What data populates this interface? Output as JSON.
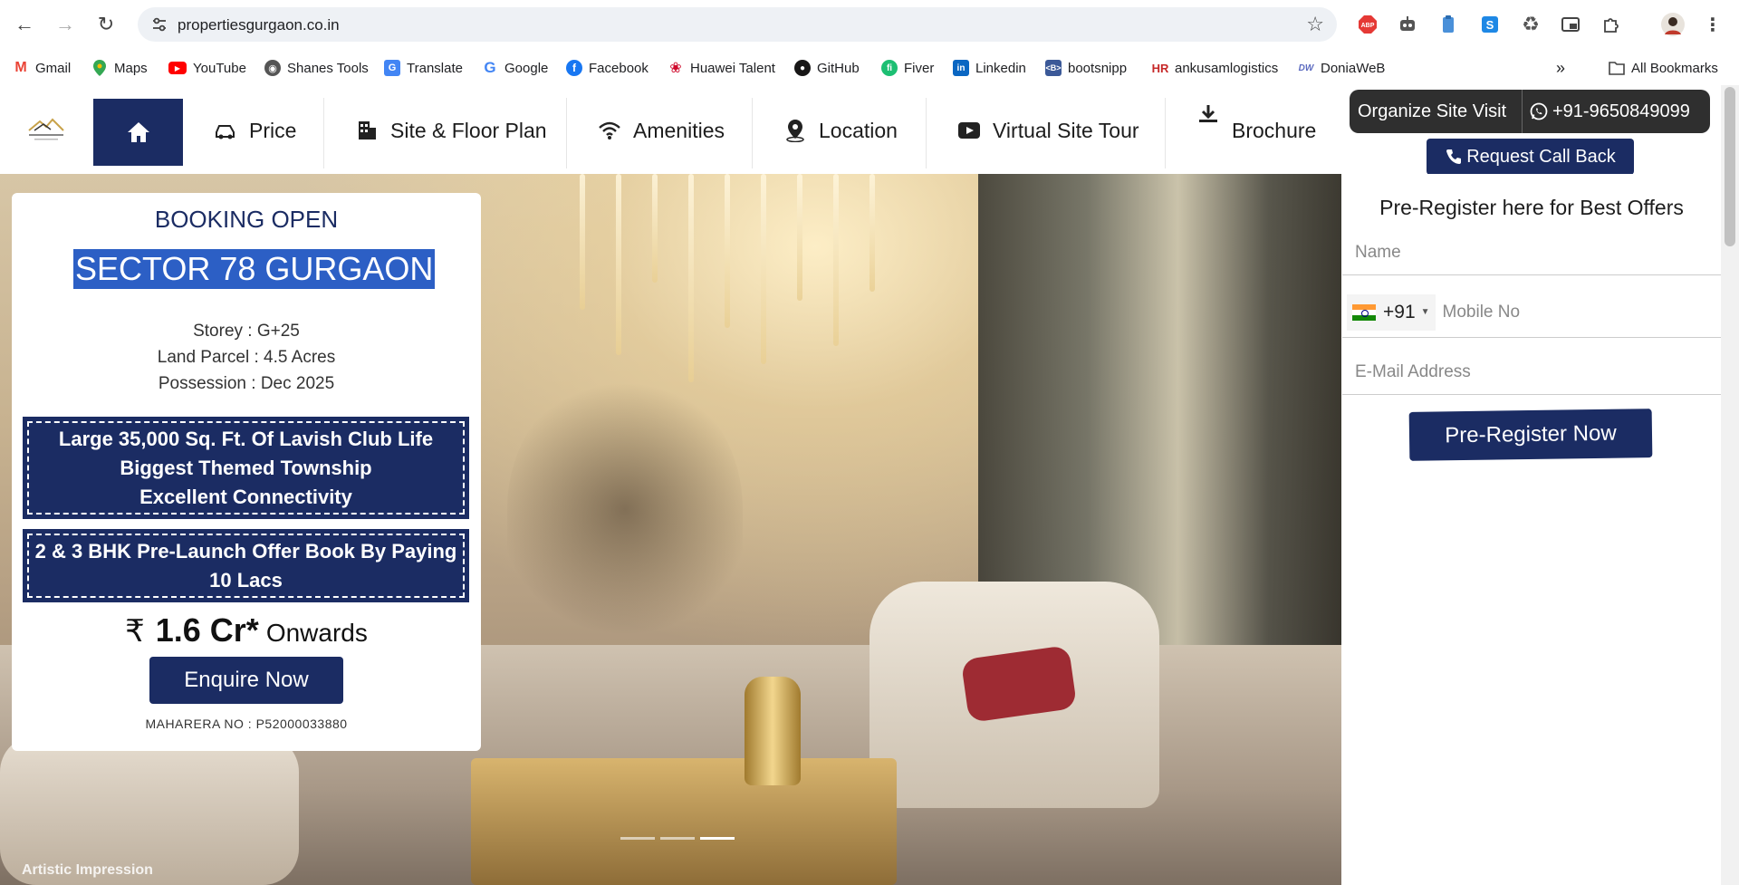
{
  "browser": {
    "url": "propertiesgurgaon.co.in",
    "bookmarks": [
      {
        "label": "Gmail",
        "icon": "gmail-icon",
        "color": "#EA4335"
      },
      {
        "label": "Maps",
        "icon": "maps-icon",
        "color": "#34A853"
      },
      {
        "label": "YouTube",
        "icon": "youtube-icon",
        "color": "#FF0000"
      },
      {
        "label": "Shanes Tools",
        "icon": "globe-icon",
        "color": "#555555"
      },
      {
        "label": "Translate",
        "icon": "translate-icon",
        "color": "#4285F4"
      },
      {
        "label": "Google",
        "icon": "google-icon",
        "color": "#4285F4"
      },
      {
        "label": "Facebook",
        "icon": "facebook-icon",
        "color": "#1877F2"
      },
      {
        "label": "Huawei Talent",
        "icon": "huawei-icon",
        "color": "#CF0A2C"
      },
      {
        "label": "GitHub",
        "icon": "github-icon",
        "color": "#181717"
      },
      {
        "label": "Fiver",
        "icon": "fiverr-icon",
        "color": "#1DBF73"
      },
      {
        "label": "Linkedin",
        "icon": "linkedin-icon",
        "color": "#0A66C2"
      },
      {
        "label": "bootsnipp",
        "icon": "bootsnipp-icon",
        "color": "#3b5998"
      },
      {
        "label": "ankusamlogistics",
        "icon": "hr-icon",
        "color": "#C62828"
      },
      {
        "label": "DoniaWeB",
        "icon": "doniaweb-icon",
        "color": "#5c6bc0"
      }
    ],
    "all_bookmarks": "All Bookmarks"
  },
  "site": {
    "nav": [
      {
        "label": "Price",
        "icon": "car-icon"
      },
      {
        "label": "Site & Floor Plan",
        "icon": "building-icon"
      },
      {
        "label": "Amenities",
        "icon": "wifi-icon"
      },
      {
        "label": "Location",
        "icon": "map-pin-icon"
      },
      {
        "label": "Virtual Site Tour",
        "icon": "youtube-play-icon"
      },
      {
        "label": "Brochure",
        "icon": "download-icon"
      }
    ],
    "organize_visit": "Organize Site Visit",
    "phone": "+91-9650849099",
    "request_callback": "Request Call Back"
  },
  "hero": {
    "booking": "BOOKING OPEN",
    "sector": "SECTOR 78 GURGAON",
    "storey": "Storey : G+25",
    "land": "Land Parcel : 4.5 Acres",
    "possession": "Possession : Dec 2025",
    "features": [
      "Large 35,000 Sq. Ft. Of Lavish Club Life",
      "Biggest Themed Township",
      "Excellent Connectivity"
    ],
    "offer_lines": [
      "2 & 3 BHK Pre-Launch Offer Book By Paying",
      "10 Lacs"
    ],
    "currency": "₹",
    "price": "1.6 Cr*",
    "onwards": "Onwards",
    "enquire": "Enquire Now",
    "rera": "MAHARERA NO : P52000033880",
    "artistic": "Artistic Impression",
    "slide_active": 3,
    "slide_count": 3
  },
  "form": {
    "title": "Pre-Register here for Best Offers",
    "name_placeholder": "Name",
    "country_code": "+91",
    "mobile_placeholder": "Mobile No",
    "email_placeholder": "E-Mail Address",
    "submit": "Pre-Register Now"
  },
  "colors": {
    "brand_navy": "#1b2c63",
    "highlight": "#2c5fc5",
    "cta_dark": "#2f2f2f"
  }
}
